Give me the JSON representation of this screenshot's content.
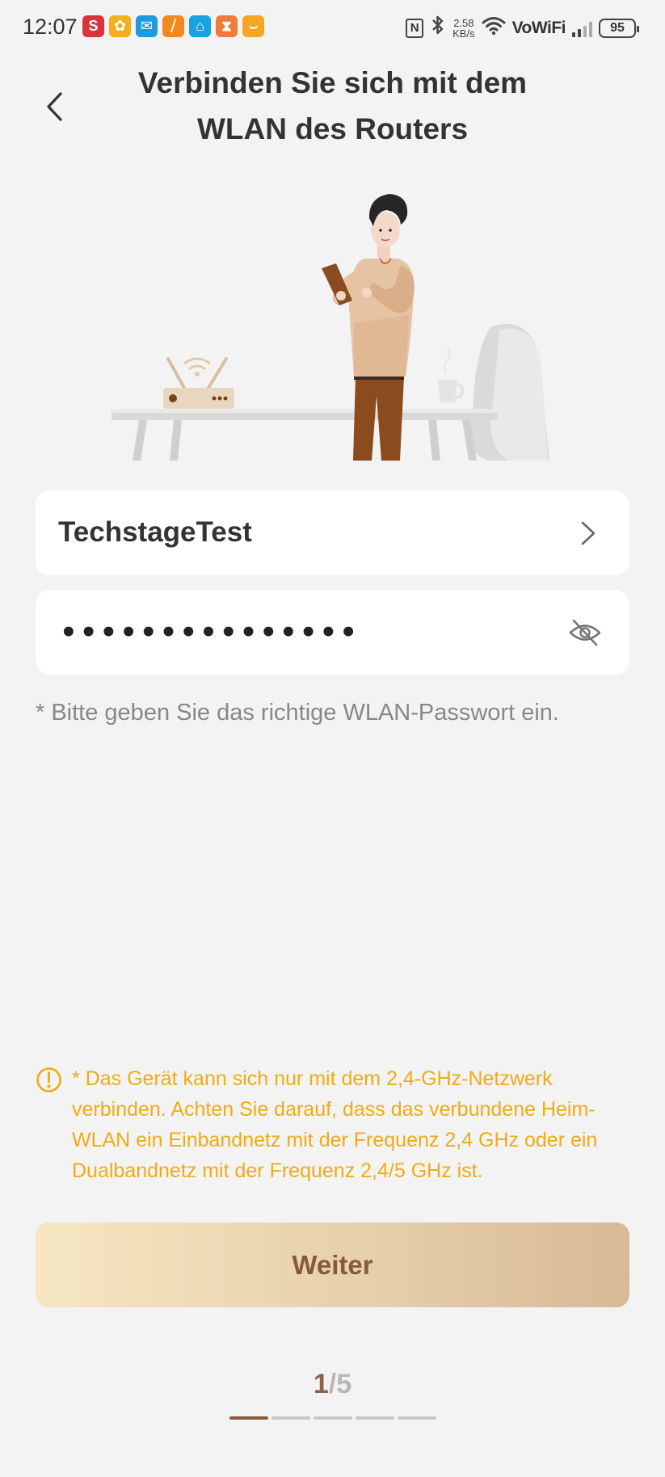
{
  "status_bar": {
    "time": "12:07",
    "app_icons": [
      {
        "name": "s-app-icon",
        "letter": "S",
        "color": "#d8343a"
      },
      {
        "name": "pinwheel-app-icon",
        "letter": "✿",
        "color": "#f2b01e"
      },
      {
        "name": "mail-app-icon",
        "letter": "✉",
        "color": "#1e9be0"
      },
      {
        "name": "slash-app-icon",
        "letter": "⧸",
        "color": "#f08a1c"
      },
      {
        "name": "home-app-icon",
        "letter": "⌂",
        "color": "#19a2e0"
      },
      {
        "name": "hourglass-app-icon",
        "letter": "⧗",
        "color": "#f07b3a"
      },
      {
        "name": "shopping-app-icon",
        "letter": "⌣",
        "color": "#f5a623"
      }
    ],
    "nfc": "N",
    "speed_value": "2.58",
    "speed_unit": "KB/s",
    "vowifi": "VoWiFi",
    "battery": "95"
  },
  "header": {
    "title": "Verbinden Sie sich mit dem WLAN des Routers"
  },
  "network": {
    "ssid": "TechstageTest",
    "password_masked": "•••••••••••••••"
  },
  "hint": "* Bitte geben Sie das richtige WLAN-Passwort ein.",
  "warning": "* Das Gerät kann sich nur mit dem 2,4-GHz-Netzwerk verbinden. Achten Sie darauf, dass das verbundene Heim-WLAN ein Einbandnetz mit der Frequenz 2,4 GHz oder ein Dualbandnetz mit der Frequenz 2,4/5 GHz ist.",
  "next_button": "Weiter",
  "pager": {
    "current": "1",
    "separator": "/",
    "total": "5",
    "steps_total": 5,
    "steps_active": 1
  },
  "colors": {
    "warning": "#f0ab15",
    "button_text": "#875a3a",
    "pager_active": "#8b5a3c"
  }
}
